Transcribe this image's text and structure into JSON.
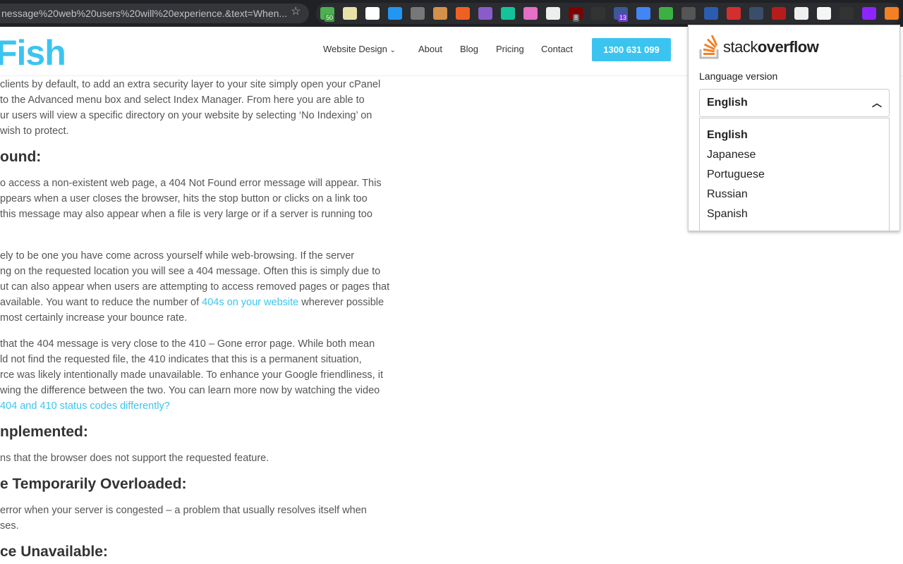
{
  "browser": {
    "url": "nessage%20web%20users%20will%20experience.&text=When...",
    "extensions": [
      {
        "name": "evernote-icon",
        "color": "#4caf50",
        "badge": "50",
        "badge_color": "#3a9a3a"
      },
      {
        "name": "notepad-icon",
        "color": "#e8e2a8"
      },
      {
        "name": "frame-icon",
        "color": "#ffffff"
      },
      {
        "name": "droplet-icon",
        "color": "#2196f3"
      },
      {
        "name": "mail-icon",
        "color": "#777777"
      },
      {
        "name": "cookie-icon",
        "color": "#d4914a"
      },
      {
        "name": "bitly-icon",
        "color": "#ee6123"
      },
      {
        "name": "feather-icon",
        "color": "#8a5cc9"
      },
      {
        "name": "grammarly-icon",
        "color": "#15c39a"
      },
      {
        "name": "gradient-icon",
        "color": "#e46fc4"
      },
      {
        "name": "json-icon",
        "color": "#eeeeee"
      },
      {
        "name": "ublock-icon",
        "color": "#800000",
        "badge": "8",
        "badge_color": "#666666"
      },
      {
        "name": "react-icon",
        "color": "#333333"
      },
      {
        "name": "font-icon",
        "color": "#3b5998",
        "badge": "13",
        "badge_color": "#6a3fc9"
      },
      {
        "name": "translate-icon",
        "color": "#4285f4"
      },
      {
        "name": "refresh-icon",
        "color": "#3cb043"
      },
      {
        "name": "window-icon",
        "color": "#555555"
      },
      {
        "name": "globe-icon",
        "color": "#2a5db0"
      },
      {
        "name": "yg-icon",
        "color": "#d32f2f"
      },
      {
        "name": "oz-icon",
        "color": "#3a4e6b"
      },
      {
        "name": "crest-icon",
        "color": "#b71c1c"
      },
      {
        "name": "circle-icon",
        "color": "#eeeeee"
      },
      {
        "name": "s-icon",
        "color": "#f5f5f5"
      },
      {
        "name": "glasses-icon",
        "color": "#333333"
      },
      {
        "name": "moon-icon",
        "color": "#8e24ff"
      },
      {
        "name": "stackoverflow-icon",
        "color": "#f48024"
      }
    ]
  },
  "site": {
    "logo": "Fish",
    "nav": [
      "Website Design",
      "About",
      "Blog",
      "Pricing",
      "Contact"
    ],
    "phone": "1300 631 099",
    "accent": "#3cc4f0"
  },
  "content": {
    "p1": [
      " clients by default, to add an extra security layer to your site simply open your cPanel",
      "to the Advanced menu box and select Index Manager. From here you are able to",
      "ur users will view a specific directory on your website by selecting ‘No Indexing’ on",
      "wish to protect."
    ],
    "h1": "ound:",
    "p2": [
      "o access a non-existent web page, a 404 Not Found error message will appear. This",
      "ppears when a user closes the browser, hits the stop button or clicks on a link too",
      " this message may also appear when a file is very large or if a server is running too"
    ],
    "p3": [
      "ely to be one you have come across yourself while web-browsing. If the server",
      "ng on the requested location you will see a 404 message. Often this is simply due to",
      "ut can also appear when users are attempting to access removed pages or pages that",
      "available. You want to reduce the number of "
    ],
    "p3_link": "404s on your website",
    "p3_after": " wherever possible",
    "p3_end": "most certainly increase your bounce rate.",
    "p4": [
      "that the 404 message is very close to the 410 – Gone error page. While both mean",
      "ld not find the requested file, the 410 indicates that this is a permanent situation,",
      "rce was likely intentionally made unavailable. To enhance your Google friendliness, it",
      "wing the difference between the two. You can learn more now by watching the video"
    ],
    "p4_link": " 404 and 410 status codes differently?",
    "h2": "nplemented:",
    "p5": "ns that the browser does not support the requested feature.",
    "h3": "e Temporarily Overloaded:",
    "p6": [
      "error when your server is congested – a problem that usually resolves itself when",
      "ses."
    ],
    "h4": "ce Unavailable:"
  },
  "popup": {
    "logo_light": "stack",
    "logo_bold": "overflow",
    "label": "Language version",
    "selected": "English",
    "options": [
      "English",
      "Japanese",
      "Portuguese",
      "Russian",
      "Spanish"
    ]
  }
}
